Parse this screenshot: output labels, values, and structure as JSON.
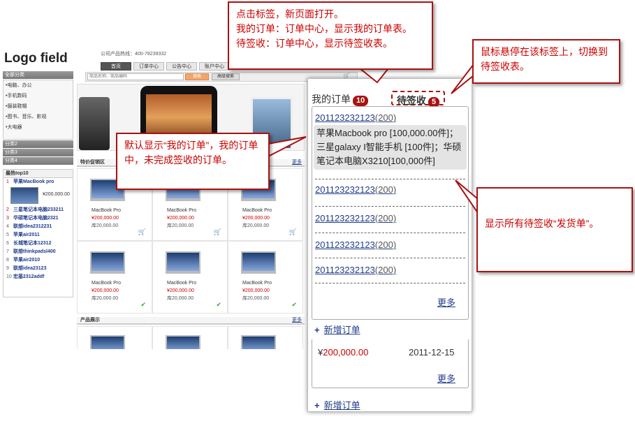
{
  "site": {
    "logo": "Logo field",
    "hotline": "公司产品热线：400-78239332",
    "nav": [
      "首页",
      "订单中心",
      "公告中心",
      "账户中心"
    ]
  },
  "search": {
    "placeholder": "商品名称、商品编码",
    "button": "搜索",
    "advanced": "高级搜索"
  },
  "sidebar": {
    "all_categories": "全部分类",
    "items": [
      "•电脑、办公",
      "•手机数码",
      "•服装鞋帽",
      "•图书、音乐、影视",
      "•大电器"
    ],
    "cats": [
      "分类2",
      "分类3",
      "分类4"
    ]
  },
  "top10": {
    "title": "最热top10",
    "items": [
      {
        "n": "1",
        "name": "苹果MacBook pro"
      },
      {
        "n": "2",
        "name": "三星笔记本电脑233211"
      },
      {
        "n": "3",
        "name": "华硕笔记本电脑2321"
      },
      {
        "n": "4",
        "name": "联想idea2312231"
      },
      {
        "n": "5",
        "name": "苹果air2011"
      },
      {
        "n": "6",
        "name": "长城笔记本12312"
      },
      {
        "n": "7",
        "name": "联想thinkpadsl400"
      },
      {
        "n": "8",
        "name": "苹果air2010"
      },
      {
        "n": "9",
        "name": "联想idea23123"
      },
      {
        "n": "10",
        "name": "宏基2312addf"
      }
    ],
    "first_price": "¥200,000.00"
  },
  "promo": {
    "title": "特价促销区",
    "more": "更多",
    "products": [
      {
        "name": "MacBook Pro",
        "price": "¥200,000.00",
        "stock": "库20,000.00"
      },
      {
        "name": "MacBook Pro",
        "price": "¥200,000.00",
        "stock": "库20,000.00"
      },
      {
        "name": "MacBook Pro",
        "price": "¥200,000.00",
        "stock": "库20,000.00"
      },
      {
        "name": "MacBook Pro",
        "price": "¥200,000.00",
        "stock": "库20,000.00"
      },
      {
        "name": "MacBook Pro",
        "price": "¥200,000.00",
        "stock": "库20,000.00"
      },
      {
        "name": "MacBook Pro",
        "price": "¥200,000.00",
        "stock": "库20,000.00"
      }
    ]
  },
  "products_section": {
    "title": "产品展示",
    "more": "更多"
  },
  "orders_panel": {
    "tab_my": "我的订单",
    "tab_my_count": "10",
    "tab_wait": "待签收",
    "tab_wait_count": "5",
    "orders": [
      {
        "id": "201123232123",
        "count": "(200)"
      },
      {
        "id": "201123232123",
        "count": "(200)"
      },
      {
        "id": "201123232123",
        "count": "(200)"
      },
      {
        "id": "201123232123",
        "count": "(200)"
      },
      {
        "id": "201123232123",
        "count": "(200)"
      }
    ],
    "detail": "苹果Macbook pro [100,000.00件]；三星galaxy I智能手机 [100件]；华硕笔记本电脑X3210[100,000件]",
    "more": "更多",
    "add_order": "新增订单",
    "old_price_symbol": "¥",
    "old_price": "200,000.00",
    "old_date": "2011-12-15",
    "old_more": "更多",
    "add_order2": "新增订单"
  },
  "callouts": {
    "c1": [
      "点击标签，新页面打开。",
      "我的订单：订单中心，显示我的订单表。",
      "待签收：订单中心，显示待签收表。"
    ],
    "c2": "鼠标悬停在该标签上，切换到待签收表。",
    "c3": "默认显示“我的订单”，我的订单中，未完成签收的订单。",
    "c4": "显示所有待签收“发货单”。"
  },
  "colors": {
    "accent": "#aa1111",
    "link": "#1f3b8a"
  }
}
